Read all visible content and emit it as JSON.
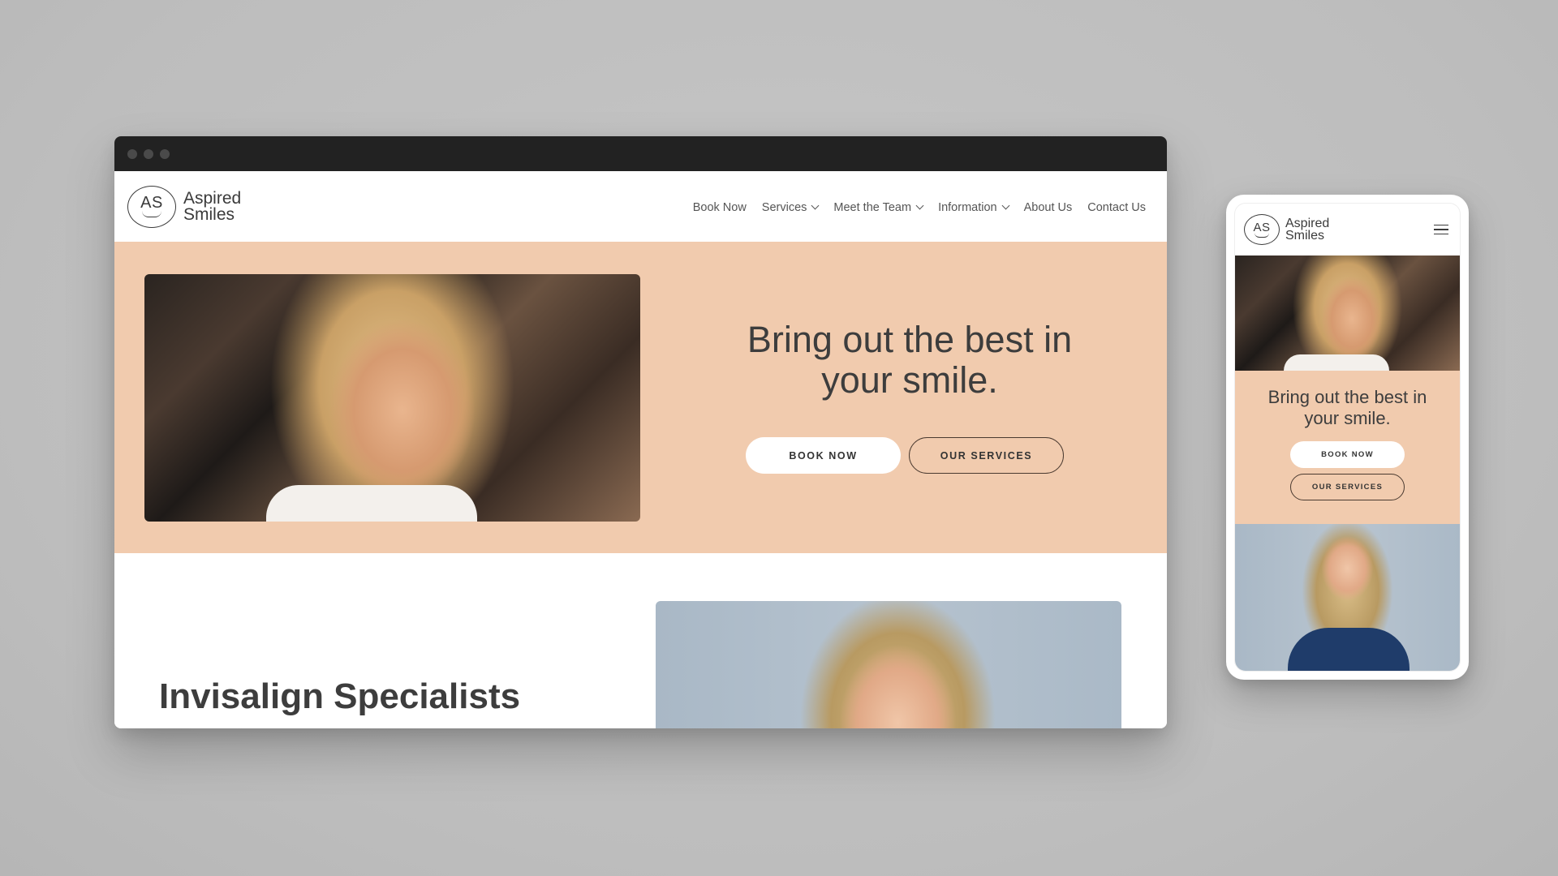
{
  "brand": {
    "initials": "AS",
    "name_line1": "Aspired",
    "name_line2": "Smiles",
    "accent_color": "#f1cbae",
    "text_color": "#3d3d3d"
  },
  "desktop": {
    "nav": [
      {
        "label": "Book Now",
        "has_dropdown": false
      },
      {
        "label": "Services",
        "has_dropdown": true
      },
      {
        "label": "Meet the Team",
        "has_dropdown": true
      },
      {
        "label": "Information",
        "has_dropdown": true
      },
      {
        "label": "About Us",
        "has_dropdown": false
      },
      {
        "label": "Contact Us",
        "has_dropdown": false
      }
    ],
    "hero": {
      "headline_line1": "Bring out the best in",
      "headline_line2": "your smile.",
      "primary_cta": "BOOK NOW",
      "secondary_cta": "OUR SERVICES",
      "image": "woman-smiling-blonde-photo"
    },
    "section2": {
      "heading": "Invisalign Specialists",
      "image": "woman-smiling-blue-background-photo"
    }
  },
  "mobile": {
    "menu_icon": "hamburger-icon",
    "hero": {
      "headline_line1": "Bring out the best in",
      "headline_line2": "your smile.",
      "primary_cta": "BOOK NOW",
      "secondary_cta": "OUR SERVICES",
      "image": "woman-smiling-blonde-photo"
    },
    "section2": {
      "image": "woman-holding-aligner-photo"
    }
  }
}
